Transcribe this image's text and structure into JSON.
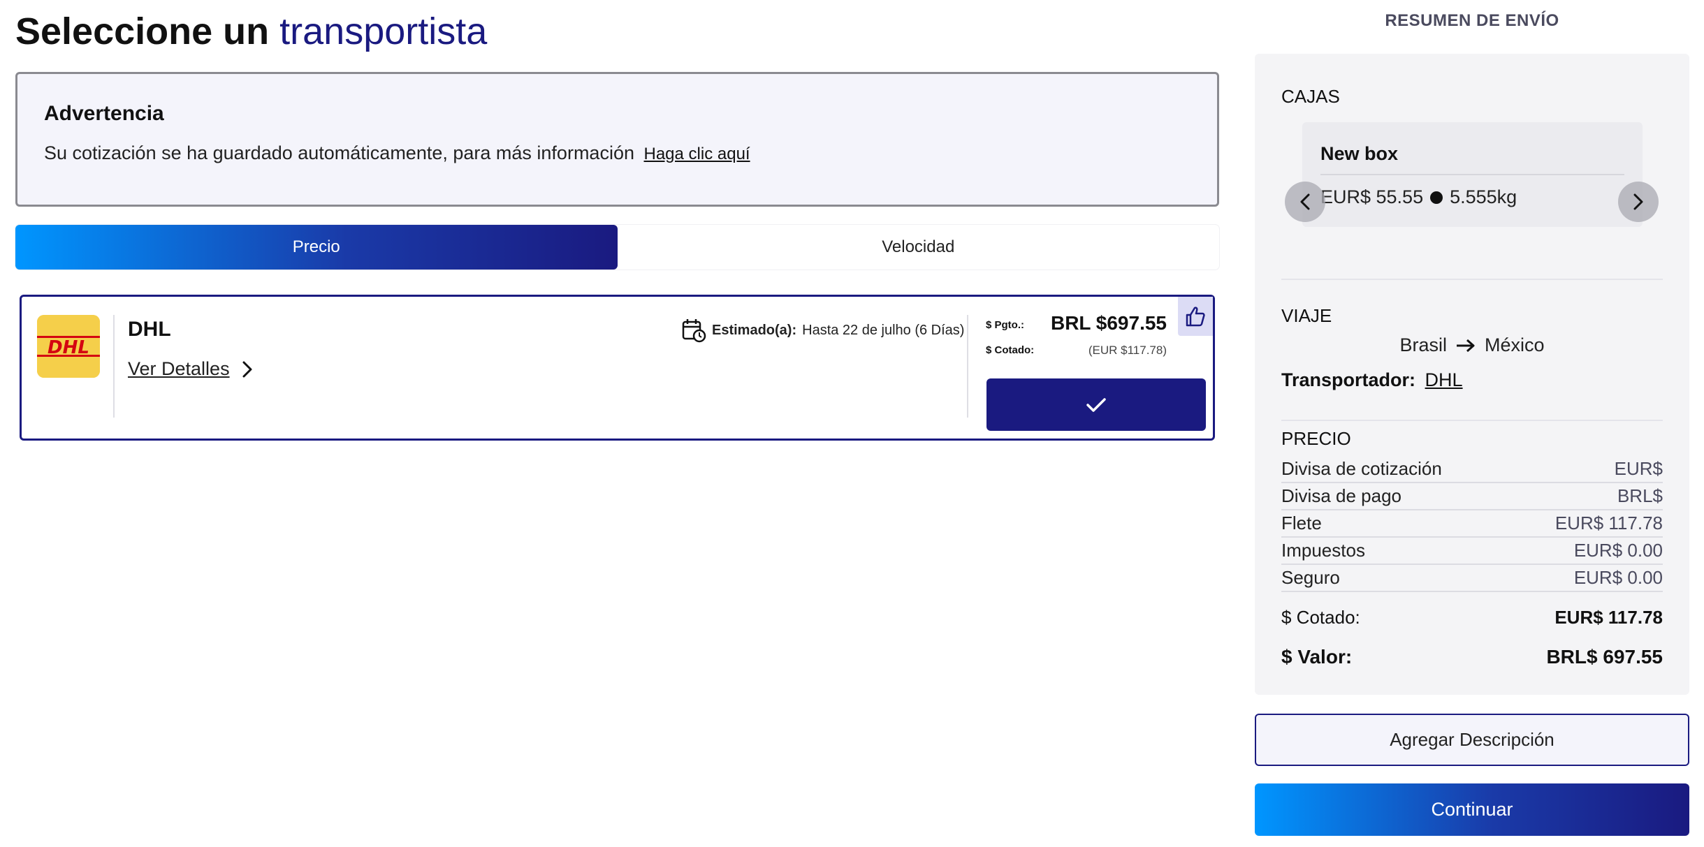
{
  "header": {
    "title_bold": "Seleccione un",
    "title_accent": "transportista"
  },
  "warning": {
    "title": "Advertencia",
    "message": "Su cotización se ha guardado automáticamente, para más información",
    "link_text": "Haga clic aquí"
  },
  "sort_tabs": [
    {
      "label": "Precio",
      "active": true
    },
    {
      "label": "Velocidad",
      "active": false
    }
  ],
  "carrier_card": {
    "name": "DHL",
    "logo_text": "DHL",
    "details_link": "Ver Detalles",
    "estimate_label": "Estimado(a):",
    "estimate_value": "Hasta 22 de julho (6 Días)",
    "pay_label": "$ Pgto.:",
    "pay_value": "BRL $697.55",
    "quoted_label": "$ Cotado:",
    "quoted_value": "(EUR $117.78)",
    "selected": true,
    "recommended": true
  },
  "summary": {
    "title": "RESUMEN DE ENVÍO",
    "boxes_title": "CAJAS",
    "box": {
      "name": "New box",
      "value": "EUR$ 55.55",
      "weight": "5.555kg"
    },
    "trip_title": "VIAJE",
    "origin": "Brasil",
    "destination": "México",
    "carrier_label": "Transportador:",
    "carrier_value": "DHL",
    "price_title": "PRECIO",
    "price_rows": [
      {
        "label": "Divisa de cotización",
        "value": "EUR$"
      },
      {
        "label": "Divisa de pago",
        "value": "BRL$"
      },
      {
        "label": "Flete",
        "value": "EUR$ 117.78"
      },
      {
        "label": "Impuestos",
        "value": "EUR$ 0.00"
      },
      {
        "label": "Seguro",
        "value": "EUR$ 0.00"
      }
    ],
    "quoted_label": "$ Cotado:",
    "quoted_value": "EUR$ 117.78",
    "total_label": "$ Valor:",
    "total_value": "BRL$ 697.55"
  },
  "actions": {
    "add_description": "Agregar Descripción",
    "continue": "Continuar"
  },
  "colors": {
    "brand_dark": "#1a1a80",
    "brand_light": "#0096ff",
    "dhl_yellow": "#f5cf4a",
    "dhl_red": "#d40511"
  },
  "icons": {
    "calendar": "calendar-clock-icon",
    "chevron": "chevron-right-icon",
    "check": "check-icon",
    "thumbs_up": "thumbs-up-icon",
    "arrow": "arrow-right-icon"
  }
}
